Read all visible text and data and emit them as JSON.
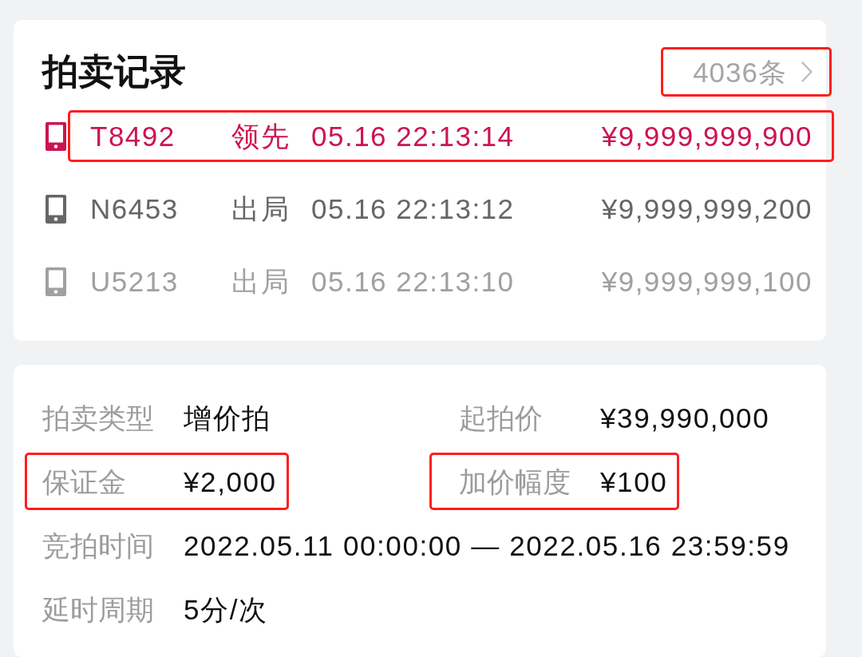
{
  "records": {
    "title": "拍卖记录",
    "count": {
      "text": "4036条",
      "highlighted": true
    },
    "rows": [
      {
        "bidder": "T8492",
        "status": "领先",
        "time": "05.16 22:13:14",
        "price": "¥9,999,999,900",
        "color": "#cc1450",
        "highlighted": true
      },
      {
        "bidder": "N6453",
        "status": "出局",
        "time": "05.16 22:13:12",
        "price": "¥9,999,999,200",
        "color": "#666666",
        "highlighted": false
      },
      {
        "bidder": "U5213",
        "status": "出局",
        "time": "05.16 22:13:10",
        "price": "¥9,999,999,100",
        "color": "#a0a0a0",
        "highlighted": false
      }
    ]
  },
  "details": {
    "rows": [
      {
        "items": [
          {
            "label": "拍卖类型",
            "value": "增价拍",
            "highlighted": false
          },
          {
            "label": "起拍价",
            "value": "¥39,990,000",
            "highlighted": false
          }
        ]
      },
      {
        "items": [
          {
            "label": "保证金",
            "value": "¥2,000",
            "highlighted": true
          },
          {
            "label": "加价幅度",
            "value": "¥100",
            "highlighted": true
          }
        ]
      },
      {
        "items": [
          {
            "label": "竞拍时间",
            "value": "2022.05.11 00:00:00 — 2022.05.16 23:59:59",
            "highlighted": false
          }
        ]
      },
      {
        "items": [
          {
            "label": "延时周期",
            "value": "5分/次",
            "highlighted": false
          }
        ]
      }
    ]
  }
}
